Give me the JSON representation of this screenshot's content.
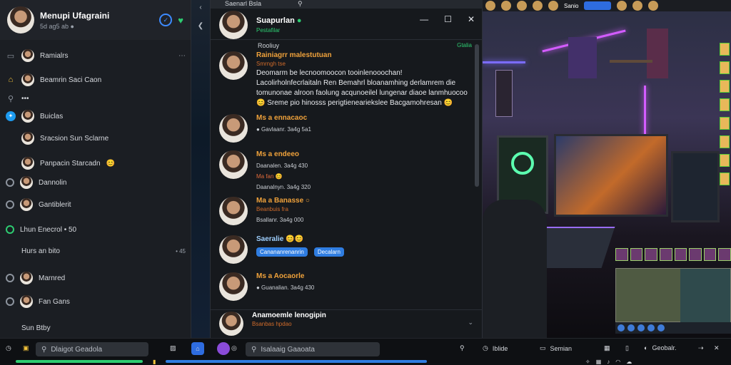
{
  "sidebar": {
    "profile_name": "Menupi Ufagraini",
    "profile_sub": "5d ag5 ab ●",
    "items": [
      {
        "label": "Ramialrs",
        "icon": "avatar"
      },
      {
        "label": "Beamrin Saci Caon",
        "icon": "avatar"
      },
      {
        "label": "•••",
        "icon": "search-icon"
      },
      {
        "label": "Buiclas",
        "icon": "twitter-icon"
      },
      {
        "label": "Sracsion Sun Sclarne",
        "icon": "avatar"
      },
      {
        "label": "Panpacin Starcadn",
        "icon": "avatar",
        "emoji": "😊"
      },
      {
        "label": "Dannolin",
        "icon": "avatar"
      },
      {
        "label": "Gantiblerit",
        "icon": "avatar"
      },
      {
        "label": "Lhun Enecrol • 50",
        "icon": "ring-icon"
      },
      {
        "label": "Hurs an bito",
        "icon": "none",
        "right": "• 45"
      },
      {
        "label": "Marnred",
        "icon": "avatar"
      },
      {
        "label": "Fan Gans",
        "icon": "avatar"
      },
      {
        "label": "Sun Btby",
        "icon": "none"
      }
    ]
  },
  "chat": {
    "window_title": "Saenarl Bsla",
    "header_name": "Suapurlan",
    "header_sub": "Pestafilar",
    "subheader_left": "Rooliuy",
    "subheader_right": "Gtalia",
    "messages": [
      {
        "who": "Rainiagrr malestutuan",
        "small": "Smrngh tse",
        "text": "Deomarm be lecnoomoocon tooinlenooochan! Lacolirholnfecrlaitaln Ren Bemahrl bloanamhing derlamrem die tomunonae alroon faolung acqunoeilel lungenar diaoe lanmhuocoo 😊 Sreme pio hinosss perigtieneariekslee Bacgamohresan 😊"
      },
      {
        "who": "Ms a ennacaoc",
        "line": "● Gavlaanr. 3a4g 5a1"
      },
      {
        "who": "Ms a endeeo",
        "line": "Daanalen. 3a4g 430",
        "line2": "Ma fan 😊",
        "line3": "Daanalnyn. 3a4g 320"
      },
      {
        "who": "Ma a Banasse ○",
        "small": "Beanbuis fra",
        "line": "Bsallanr. 3a4g 000"
      },
      {
        "who": "Saeralie 😊😊",
        "chips": [
          "Canananrenanrin",
          "Decalarn"
        ]
      },
      {
        "who": "Ms a Aocaorle",
        "line": "● Guanalian. 3a4g 430"
      },
      {
        "who": "Anamoemle lenogipin",
        "small": "Bsanbas hpdao"
      }
    ]
  },
  "scene": {
    "top_label": "Sanio"
  },
  "taskbar": {
    "search_left_placeholder": "Dlaigot Geadola",
    "search_mid_placeholder": "Isalaaig Gaaoata",
    "tray": [
      "Iblide",
      "Semian",
      "Geobalr."
    ]
  }
}
